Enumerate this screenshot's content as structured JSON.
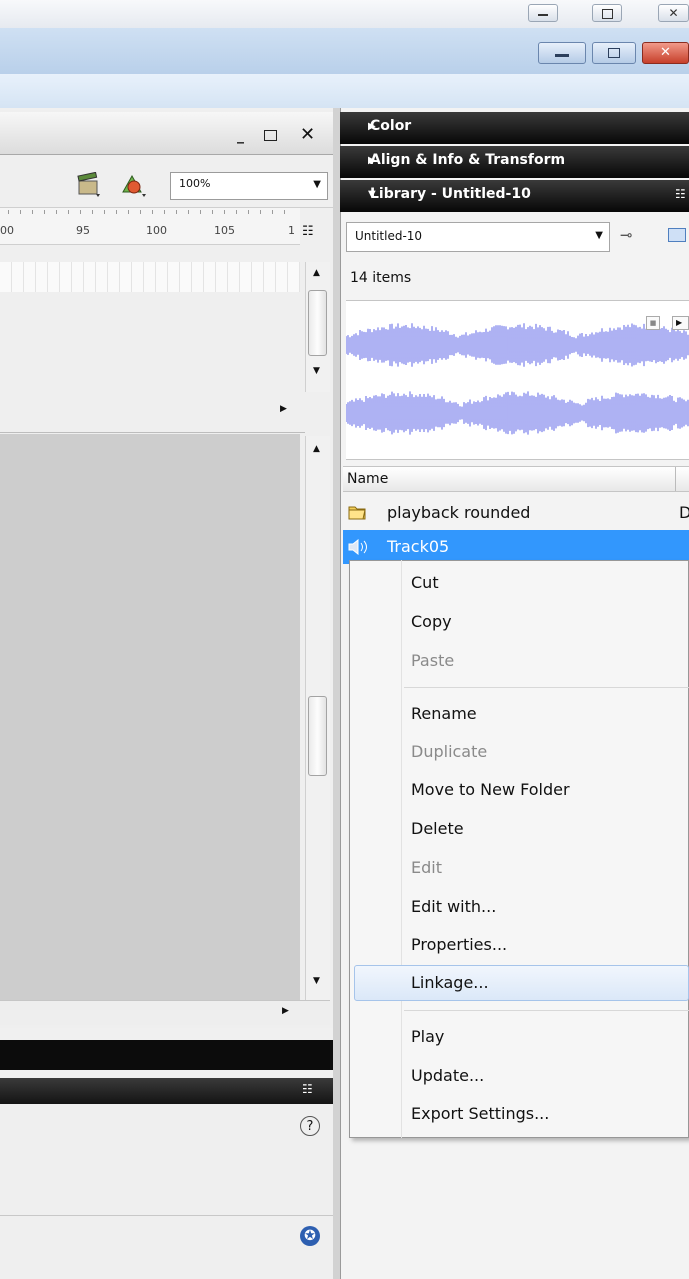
{
  "timeline": {
    "zoom_value": "100%",
    "ruler_labels": [
      "00",
      "95",
      "100",
      "105",
      "1"
    ]
  },
  "panels": {
    "color_label": "Color",
    "align_label": "Align & Info & Transform",
    "library_label": "Library - Untitled-10"
  },
  "library": {
    "document_select_value": "Untitled-10",
    "items_count": "14 items",
    "column_name": "Name",
    "items": [
      {
        "label": "playback rounded",
        "icon": "folder-icon",
        "type_hint": "D"
      },
      {
        "label": "Track05",
        "icon": "sound-icon",
        "selected": true
      }
    ],
    "waveform_color": "#9a9ef0",
    "selection_color": "#3297fd"
  },
  "context_menu": {
    "items": [
      {
        "label": "Cut",
        "enabled": true
      },
      {
        "label": "Copy",
        "enabled": true
      },
      {
        "label": "Paste",
        "enabled": false
      },
      {
        "label": "Rename",
        "enabled": true
      },
      {
        "label": "Duplicate",
        "enabled": false
      },
      {
        "label": "Move to New Folder",
        "enabled": true
      },
      {
        "label": "Delete",
        "enabled": true
      },
      {
        "label": "Edit",
        "enabled": false
      },
      {
        "label": "Edit with...",
        "enabled": true
      },
      {
        "label": "Properties...",
        "enabled": true
      },
      {
        "label": "Linkage...",
        "enabled": true,
        "highlighted": true
      },
      {
        "label": "Play",
        "enabled": true
      },
      {
        "label": "Update...",
        "enabled": true
      },
      {
        "label": "Export Settings...",
        "enabled": true
      }
    ]
  },
  "icons": {
    "minimize": "minimize-icon",
    "restore": "restore-icon",
    "close": "close-icon",
    "help": "help-icon",
    "accessibility": "accessibility-icon"
  }
}
